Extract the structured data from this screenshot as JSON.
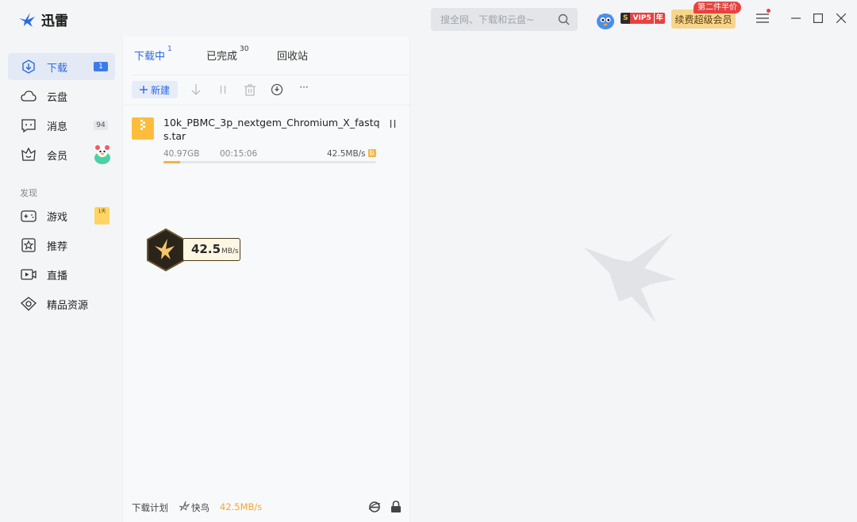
{
  "app": {
    "title": "迅雷"
  },
  "search": {
    "placeholder": "搜全网、下载和云盘~"
  },
  "vip": {
    "s": "S",
    "text": "VIP5",
    "year": "年"
  },
  "renew": {
    "label": "续费超级会员",
    "promo": "第二件半价"
  },
  "sidebar": {
    "items": [
      {
        "label": "下载",
        "count": "1"
      },
      {
        "label": "云盘"
      },
      {
        "label": "消息",
        "count": "94"
      },
      {
        "label": "会员"
      }
    ],
    "section": "发现",
    "discover": [
      {
        "label": "游戏",
        "badge": "1天"
      },
      {
        "label": "推荐"
      },
      {
        "label": "直播"
      },
      {
        "label": "精品资源"
      }
    ]
  },
  "tabs": [
    {
      "label": "下载中",
      "count": "1"
    },
    {
      "label": "已完成",
      "count": "30"
    },
    {
      "label": "回收站"
    }
  ],
  "toolbar": {
    "new_label": "新建",
    "more": "···"
  },
  "task": {
    "name": "10k_PBMC_3p_nextgem_Chromium_X_fastqs.tar",
    "size": "40.97GB",
    "time": "00:15:06",
    "speed": "42.5MB/s",
    "speed_tag": "臥",
    "progress": 0.08
  },
  "speed_widget": {
    "value": "42.5",
    "unit": "MB/s"
  },
  "bottom": {
    "plan": "下载计划",
    "bird": "快鸟",
    "speed": "42.5MB/s"
  },
  "colors": {
    "accent": "#2a6ae4",
    "file": "#fdbd3c",
    "progress": "#f0b444",
    "promo": "#e8423f"
  }
}
